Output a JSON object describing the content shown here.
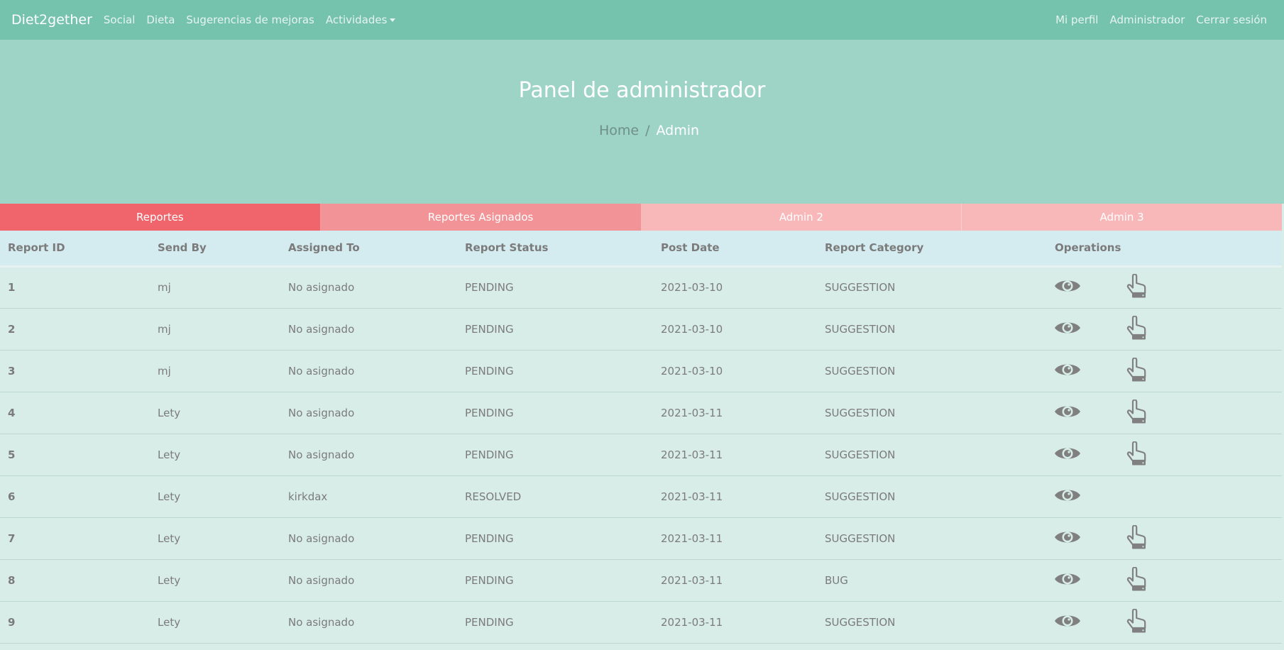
{
  "navbar": {
    "brand": "Diet2gether",
    "left_links": [
      "Social",
      "Dieta",
      "Sugerencias de mejoras"
    ],
    "dropdown_label": "Actividades",
    "right_links": [
      "Mi perfil",
      "Administrador",
      "Cerrar sesión"
    ]
  },
  "hero": {
    "title": "Panel de administrador",
    "breadcrumb": {
      "home": "Home",
      "separator": "/",
      "current": "Admin"
    }
  },
  "tabs": [
    "Reportes",
    "Reportes Asignados",
    "Admin 2",
    "Admin 3"
  ],
  "table": {
    "headers": [
      "Report ID",
      "Send By",
      "Assigned To",
      "Report Status",
      "Post Date",
      "Report Category",
      "Operations"
    ],
    "rows": [
      {
        "id": "1",
        "send_by": "mj",
        "assigned_to": "No asignado",
        "status": "PENDING",
        "date": "2021-03-10",
        "category": "SUGGESTION",
        "can_assign": true
      },
      {
        "id": "2",
        "send_by": "mj",
        "assigned_to": "No asignado",
        "status": "PENDING",
        "date": "2021-03-10",
        "category": "SUGGESTION",
        "can_assign": true
      },
      {
        "id": "3",
        "send_by": "mj",
        "assigned_to": "No asignado",
        "status": "PENDING",
        "date": "2021-03-10",
        "category": "SUGGESTION",
        "can_assign": true
      },
      {
        "id": "4",
        "send_by": "Lety",
        "assigned_to": "No asignado",
        "status": "PENDING",
        "date": "2021-03-11",
        "category": "SUGGESTION",
        "can_assign": true
      },
      {
        "id": "5",
        "send_by": "Lety",
        "assigned_to": "No asignado",
        "status": "PENDING",
        "date": "2021-03-11",
        "category": "SUGGESTION",
        "can_assign": true
      },
      {
        "id": "6",
        "send_by": "Lety",
        "assigned_to": "kirkdax",
        "status": "RESOLVED",
        "date": "2021-03-11",
        "category": "SUGGESTION",
        "can_assign": false
      },
      {
        "id": "7",
        "send_by": "Lety",
        "assigned_to": "No asignado",
        "status": "PENDING",
        "date": "2021-03-11",
        "category": "SUGGESTION",
        "can_assign": true
      },
      {
        "id": "8",
        "send_by": "Lety",
        "assigned_to": "No asignado",
        "status": "PENDING",
        "date": "2021-03-11",
        "category": "BUG",
        "can_assign": true
      },
      {
        "id": "9",
        "send_by": "Lety",
        "assigned_to": "No asignado",
        "status": "PENDING",
        "date": "2021-03-11",
        "category": "SUGGESTION",
        "can_assign": true
      }
    ]
  },
  "icons": {
    "view": "eye-icon",
    "assign": "pointing-hand-icon"
  },
  "colors": {
    "navbar": "#75c2ad",
    "hero": "#9dd4c5",
    "tab_active": "#f0656c",
    "tab_secondary": "#f29497",
    "tab_inactive": "#f8b8b9",
    "table_header": "#d4ebf0",
    "table_body": "#d8ede7",
    "icon": "#808080"
  }
}
